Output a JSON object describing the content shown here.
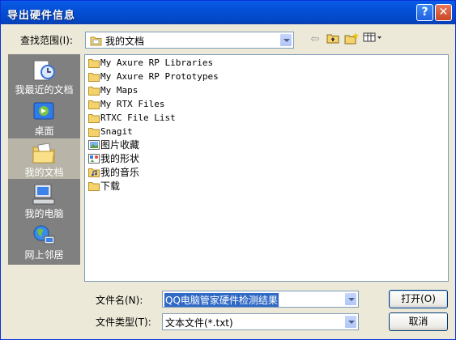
{
  "window": {
    "title": "导出硬件信息"
  },
  "titlebar": {
    "help_label": "?",
    "close_label": "✕"
  },
  "lookin": {
    "label": "查找范围(I):",
    "value": "我的文档"
  },
  "places": [
    {
      "label": "我最近的文档",
      "icon": "recent-documents-icon"
    },
    {
      "label": "桌面",
      "icon": "desktop-icon"
    },
    {
      "label": "我的文档",
      "icon": "my-documents-icon",
      "selected": true
    },
    {
      "label": "我的电脑",
      "icon": "my-computer-icon"
    },
    {
      "label": "网上邻居",
      "icon": "network-places-icon"
    }
  ],
  "files": [
    {
      "name": "My Axure RP Libraries",
      "icon": "folder-icon"
    },
    {
      "name": "My Axure RP Prototypes",
      "icon": "folder-icon"
    },
    {
      "name": "My Maps",
      "icon": "folder-icon"
    },
    {
      "name": "My RTX Files",
      "icon": "folder-icon"
    },
    {
      "name": "RTXC File List",
      "icon": "folder-icon"
    },
    {
      "name": "Snagit",
      "icon": "folder-icon"
    },
    {
      "name": "图片收藏",
      "icon": "pictures-folder-icon"
    },
    {
      "name": "我的形状",
      "icon": "shapes-folder-icon"
    },
    {
      "name": "我的音乐",
      "icon": "music-folder-icon"
    },
    {
      "name": "下载",
      "icon": "folder-icon"
    }
  ],
  "filename": {
    "label": "文件名(N):",
    "value": "QQ电脑管家硬件检测结果"
  },
  "filetype": {
    "label": "文件类型(T):",
    "value": "文本文件(*.txt)"
  },
  "buttons": {
    "open": "打开(O)",
    "cancel": "取消"
  },
  "colors": {
    "title_bar": "#0450d6",
    "dialog_bg": "#ece9d8",
    "selection": "#316ac5",
    "folder": "#f5d36c"
  }
}
